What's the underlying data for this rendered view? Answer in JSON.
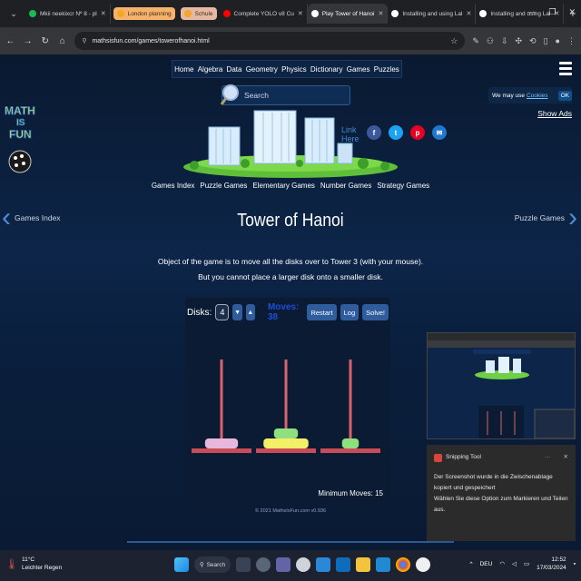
{
  "browser": {
    "tabs": [
      {
        "label": "Mkii neekixcr Nº 8 - pl",
        "color": "#1db954"
      },
      {
        "label": "London planning",
        "color": "#f5a623",
        "pill": "#f6b26b"
      },
      {
        "label": "Schule",
        "color": "#f5a623",
        "pill": "#e6b8a2"
      },
      {
        "label": "Complete YOLO v8 Cu",
        "color": "#ff0000"
      },
      {
        "label": "Play Tower of Hanoi",
        "color": "#ffffff",
        "active": true
      },
      {
        "label": "Installing and using Lal",
        "color": "#ffffff"
      },
      {
        "label": "Installing and using Lal",
        "color": "#ffffff"
      }
    ],
    "url": "mathsisfun.com/games/towerofhanoi.html"
  },
  "nav": {
    "items": [
      "Home",
      "Algebra",
      "Data",
      "Geometry",
      "Physics",
      "Dictionary",
      "Games",
      "Puzzles"
    ]
  },
  "search": {
    "placeholder": "Search"
  },
  "cookies": {
    "text": "We may use",
    "link": "Cookies",
    "ok": "OK"
  },
  "show_ads": "Show Ads",
  "logo": {
    "line1": "MATH",
    "line2": "IS",
    "line3": "FUN"
  },
  "link_here": {
    "line1": "Link",
    "line2": "Here"
  },
  "subnav": [
    "Games Index",
    "Puzzle Games",
    "Elementary Games",
    "Number Games",
    "Strategy Games"
  ],
  "side": {
    "left": "Games Index",
    "right": "Puzzle Games"
  },
  "title": "Tower of Hanoi",
  "description": {
    "line1": "Object of the game is to move all the disks over to Tower 3 (with your mouse).",
    "line2": "But you cannot place a larger disk onto a smaller disk."
  },
  "game": {
    "disks_label": "Disks:",
    "disks_value": "4",
    "moves_label": "Moves: 38",
    "buttons": [
      "Restart",
      "Log",
      "Solve!"
    ],
    "min_moves": "Minimum Moves: 15",
    "pegs": [
      {
        "disks": [
          {
            "width_frac": 0.55,
            "color": "#e5b8dc"
          }
        ]
      },
      {
        "disks": [
          {
            "width_frac": 0.75,
            "color": "#f3f068"
          },
          {
            "width_frac": 0.4,
            "color": "#8ee07e"
          }
        ]
      },
      {
        "disks": [
          {
            "width_frac": 0.28,
            "color": "#8ee07e"
          }
        ]
      }
    ],
    "peg_color": "#d9636b",
    "base_color": "#c94d57"
  },
  "copyright": "© 2021 MathsIsFun.com v0.936",
  "snipping": {
    "app": "Snipping Tool",
    "message1": "Der Screenshot wurde in die Zwischenablage kopiert und gespeichert",
    "message2": "Wählen Sie diese Option zum Markieren und Teilen aus."
  },
  "taskbar": {
    "temp": "11°C",
    "weather": "Leichter Regen",
    "search": "Search",
    "lang": "DEU",
    "time": "12:52",
    "date": "17/03/2024"
  }
}
